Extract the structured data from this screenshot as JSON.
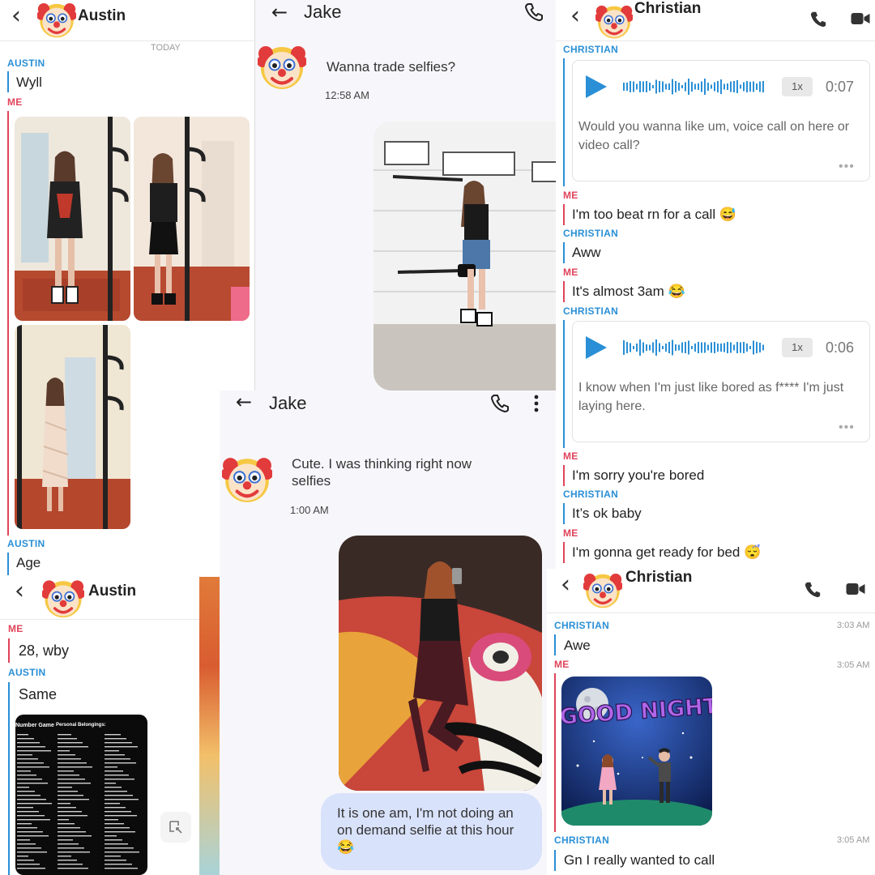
{
  "panel_austin_top": {
    "contact_name": "Austin",
    "date_divider": "TODAY",
    "messages": [
      {
        "sender": "AUSTIN",
        "text": "Wyll"
      },
      {
        "sender": "ME",
        "text": ""
      },
      {
        "sender": "AUSTIN",
        "text": "Age"
      }
    ]
  },
  "panel_jake_top": {
    "contact_name": "Jake",
    "message": "Wanna trade selfies?",
    "time": "12:58 AM"
  },
  "panel_christian_top": {
    "contact_name": "Christian",
    "voice_notes": [
      {
        "speed": "1x",
        "duration": "0:07",
        "transcript": "Would you wanna like um, voice call on here or video call?"
      },
      {
        "speed": "1x",
        "duration": "0:06",
        "transcript": "I know when I'm just like bored as f**** I'm just laying here."
      }
    ],
    "messages": [
      {
        "sender": "CHRISTIAN",
        "text": ""
      },
      {
        "sender": "ME",
        "text": "I'm too beat rn for a call 😅"
      },
      {
        "sender": "CHRISTIAN",
        "text": "Aww"
      },
      {
        "sender": "ME",
        "text": "It's almost 3am 😂"
      },
      {
        "sender": "CHRISTIAN",
        "text": ""
      },
      {
        "sender": "ME",
        "text": "I'm sorry you're bored"
      },
      {
        "sender": "CHRISTIAN",
        "text": "It’s ok baby"
      },
      {
        "sender": "ME",
        "text": "I'm gonna get ready for bed 😴"
      }
    ],
    "more_dots": "•••"
  },
  "panel_jake_mid": {
    "contact_name": "Jake",
    "message": "Cute. I was thinking right now selfies",
    "time": "1:00 AM",
    "outgoing": "It is one am, I'm not doing an on demand selfie at this hour 😂"
  },
  "panel_austin_bottom": {
    "contact_name": "Austin",
    "messages": [
      {
        "sender": "ME",
        "text": "28, wby"
      },
      {
        "sender": "AUSTIN",
        "text": "Same"
      }
    ],
    "number_game_title": "Number Game",
    "number_game_heading": "Personal Belongings:"
  },
  "panel_christian_bottom": {
    "contact_name": "Christian",
    "messages": [
      {
        "sender": "CHRISTIAN",
        "text": "Awe",
        "time": "3:03 AM"
      },
      {
        "sender": "ME",
        "text": "",
        "time": "3:05 AM"
      },
      {
        "sender": "CHRISTIAN",
        "text": "Gn I really wanted to call",
        "time": "3:05 AM"
      }
    ],
    "sticker_text": "GOOD NIGHT"
  },
  "colors": {
    "snap_blue": "#2a8fd6",
    "snap_red": "#e0445b",
    "sms_bubble": "#d9e2fb"
  },
  "icons": [
    "clown-avatar-icon",
    "back-arrow-icon",
    "phone-icon",
    "video-icon",
    "more-vert-icon",
    "play-icon",
    "waveform-icon"
  ]
}
